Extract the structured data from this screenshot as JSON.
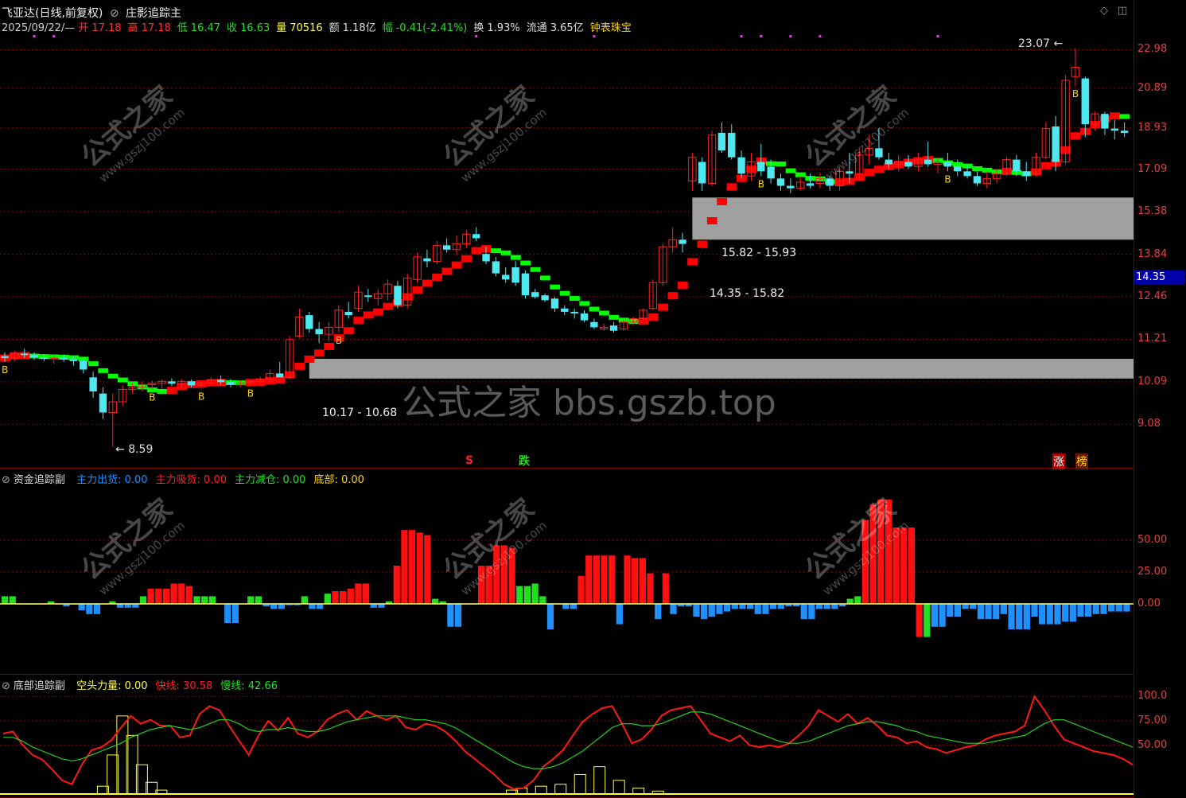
{
  "header": {
    "stock_name": "飞亚达(日线,前复权)",
    "indicator_name": "庄影追踪主",
    "date": "2025/09/22/—",
    "open_label": "开",
    "open": "17.18",
    "high_label": "高",
    "high": "17.18",
    "low_label": "低",
    "low": "16.47",
    "close_label": "收",
    "close": "16.63",
    "volume_label": "量",
    "volume": "70516",
    "amount_label": "额",
    "amount": "1.18亿",
    "change_label": "幅",
    "change": "-0.41(-2.41%)",
    "turnover_label": "换",
    "turnover": "1.93%",
    "float_label": "流通",
    "float": "3.65亿",
    "sector": "钟表珠宝"
  },
  "colors": {
    "up": "#ff2020",
    "down": "#50e8f0",
    "ma_up": "#ff0000",
    "ma_down": "#00ff00",
    "grid": "#8b0000",
    "gray_box": "#a0a0a0"
  },
  "price_axis": [
    "22.98",
    "20.89",
    "18.93",
    "17.09",
    "15.38",
    "13.84",
    "12.46",
    "11.21",
    "10.09",
    "9.08"
  ],
  "current_price": "14.35",
  "annotations": {
    "high_mark": "23.07",
    "low_mark": "8.59",
    "box_upper_top": "15.82 - 15.93",
    "box_upper_bottom": "14.35 - 15.82",
    "box_lower": "10.17 - 10.68",
    "signal_s": "S",
    "signal_die": "跌",
    "signal_zhang": "涨",
    "signal_bang": "榜",
    "buy_mark": "B",
    "watermark_cn": "公式之家",
    "watermark_url": "www.gszj100.com",
    "watermark_big": "公式之家 bbs.gszb.top"
  },
  "panel2": {
    "title": "资金追踪副",
    "items": [
      {
        "label": "主力出货:",
        "value": "0.00",
        "color": "#1e90ff"
      },
      {
        "label": "主力吸货:",
        "value": "0.00",
        "color": "#ff2020"
      },
      {
        "label": "主力减仓:",
        "value": "0.00",
        "color": "#20e020"
      },
      {
        "label": "底部:",
        "value": "0.00",
        "color": "#ffd700"
      }
    ],
    "axis": [
      "50.00",
      "25.00",
      "0.00"
    ]
  },
  "panel3": {
    "title": "底部追踪副",
    "items": [
      {
        "label": "空头力量:",
        "value": "0.00",
        "color": "#ffff40"
      },
      {
        "label": "快线:",
        "value": "30.58",
        "color": "#ff2020"
      },
      {
        "label": "慢线:",
        "value": "42.66",
        "color": "#20e020"
      }
    ],
    "axis": [
      "100.0",
      "75.00",
      "50.00"
    ]
  },
  "chart_data": [
    {
      "type": "candlestick",
      "title": "庄影追踪主",
      "ylim": [
        8.2,
        24.5
      ],
      "log_scale": true,
      "candles": [
        [
          10.75,
          10.85,
          10.6,
          10.7
        ],
        [
          10.7,
          10.9,
          10.62,
          10.82
        ],
        [
          10.82,
          10.95,
          10.7,
          10.78
        ],
        [
          10.78,
          10.85,
          10.65,
          10.72
        ],
        [
          10.72,
          10.8,
          10.62,
          10.68
        ],
        [
          10.68,
          10.78,
          10.55,
          10.7
        ],
        [
          10.7,
          10.8,
          10.6,
          10.66
        ],
        [
          10.66,
          10.74,
          10.5,
          10.62
        ],
        [
          10.62,
          10.68,
          10.3,
          10.4
        ],
        [
          10.2,
          10.35,
          9.7,
          9.85
        ],
        [
          9.8,
          9.95,
          9.2,
          9.35
        ],
        [
          9.35,
          9.8,
          8.59,
          9.6
        ],
        [
          9.6,
          10.0,
          9.5,
          9.9
        ],
        [
          9.9,
          10.05,
          9.8,
          9.95
        ],
        [
          9.95,
          10.1,
          9.85,
          10.02
        ],
        [
          10.02,
          10.12,
          9.9,
          10.05
        ],
        [
          10.05,
          10.15,
          9.92,
          10.1
        ],
        [
          10.1,
          10.18,
          9.98,
          10.04
        ],
        [
          10.04,
          10.16,
          9.96,
          10.1
        ],
        [
          10.1,
          10.15,
          9.95,
          10.0
        ],
        [
          10.0,
          10.1,
          9.92,
          10.06
        ],
        [
          10.06,
          10.2,
          9.98,
          10.14
        ],
        [
          10.14,
          10.25,
          10.0,
          10.08
        ],
        [
          10.08,
          10.16,
          9.95,
          10.02
        ],
        [
          10.02,
          10.12,
          9.96,
          10.06
        ],
        [
          10.06,
          10.15,
          10.0,
          10.1
        ],
        [
          10.1,
          10.22,
          10.02,
          10.16
        ],
        [
          10.16,
          10.4,
          10.08,
          10.3
        ],
        [
          10.3,
          10.6,
          10.2,
          10.2
        ],
        [
          10.2,
          11.3,
          10.15,
          11.2
        ],
        [
          11.3,
          12.1,
          11.25,
          11.85
        ],
        [
          11.9,
          12.0,
          11.4,
          11.5
        ],
        [
          11.5,
          11.7,
          11.1,
          11.35
        ],
        [
          11.35,
          11.7,
          11.15,
          11.55
        ],
        [
          11.55,
          12.2,
          11.4,
          12.05
        ],
        [
          12.0,
          12.3,
          11.8,
          11.9
        ],
        [
          12.1,
          12.8,
          12.0,
          12.6
        ],
        [
          12.5,
          12.7,
          12.3,
          12.45
        ],
        [
          12.4,
          12.7,
          12.2,
          12.55
        ],
        [
          12.55,
          13.0,
          12.35,
          12.85
        ],
        [
          12.8,
          12.95,
          12.1,
          12.2
        ],
        [
          12.2,
          13.2,
          12.1,
          13.05
        ],
        [
          13.0,
          13.9,
          12.9,
          13.75
        ],
        [
          13.7,
          14.0,
          13.4,
          13.6
        ],
        [
          13.6,
          14.3,
          13.5,
          14.15
        ],
        [
          14.15,
          14.4,
          13.9,
          14.0
        ],
        [
          14.0,
          14.5,
          13.8,
          14.2
        ],
        [
          14.2,
          14.7,
          14.05,
          14.55
        ],
        [
          14.55,
          14.8,
          14.3,
          14.4
        ],
        [
          13.85,
          14.1,
          13.5,
          13.6
        ],
        [
          13.6,
          13.75,
          13.1,
          13.2
        ],
        [
          13.15,
          13.4,
          12.9,
          13.0
        ],
        [
          13.4,
          13.6,
          12.8,
          12.9
        ],
        [
          13.2,
          13.3,
          12.4,
          12.5
        ],
        [
          12.6,
          12.7,
          12.4,
          12.45
        ],
        [
          12.5,
          12.55,
          12.3,
          12.35
        ],
        [
          12.4,
          12.45,
          12.0,
          12.1
        ],
        [
          12.1,
          12.2,
          11.9,
          12.0
        ],
        [
          12.0,
          12.1,
          11.8,
          11.95
        ],
        [
          11.95,
          12.05,
          11.7,
          11.75
        ],
        [
          11.7,
          11.8,
          11.5,
          11.55
        ],
        [
          11.5,
          11.65,
          11.45,
          11.55
        ],
        [
          11.6,
          11.7,
          11.4,
          11.45
        ],
        [
          11.5,
          11.75,
          11.45,
          11.7
        ],
        [
          11.7,
          11.85,
          11.6,
          11.8
        ],
        [
          11.8,
          12.1,
          11.75,
          12.05
        ],
        [
          12.1,
          13.0,
          12.05,
          12.9
        ],
        [
          12.9,
          14.2,
          12.8,
          14.1
        ],
        [
          14.1,
          14.8,
          13.9,
          14.35
        ],
        [
          14.35,
          14.6,
          13.9,
          14.2
        ],
        [
          16.6,
          17.8,
          16.2,
          17.6
        ],
        [
          17.4,
          17.6,
          16.2,
          16.5
        ],
        [
          16.5,
          18.8,
          16.4,
          18.6
        ],
        [
          18.7,
          19.2,
          17.8,
          17.9
        ],
        [
          18.7,
          19.1,
          17.5,
          17.6
        ],
        [
          17.6,
          17.9,
          16.7,
          16.9
        ],
        [
          16.8,
          17.8,
          16.6,
          17.4
        ],
        [
          17.4,
          18.2,
          16.8,
          17.0
        ],
        [
          17.2,
          17.5,
          16.5,
          16.7
        ],
        [
          16.7,
          16.9,
          16.2,
          16.4
        ],
        [
          16.4,
          16.7,
          16.1,
          16.3
        ],
        [
          16.3,
          16.8,
          16.2,
          16.55
        ],
        [
          16.5,
          16.9,
          16.3,
          16.4
        ],
        [
          16.5,
          16.95,
          16.3,
          16.7
        ],
        [
          16.7,
          16.8,
          16.2,
          16.4
        ],
        [
          16.4,
          17.2,
          16.2,
          17.0
        ],
        [
          17.0,
          17.8,
          16.5,
          16.9
        ],
        [
          16.9,
          18.0,
          16.6,
          17.7
        ],
        [
          17.7,
          18.6,
          17.3,
          18.0
        ],
        [
          18.0,
          18.9,
          17.5,
          17.6
        ],
        [
          17.5,
          17.8,
          17.1,
          17.3
        ],
        [
          17.3,
          17.7,
          17.0,
          17.4
        ],
        [
          17.4,
          17.7,
          17.1,
          17.2
        ],
        [
          17.2,
          17.8,
          17.0,
          17.5
        ],
        [
          17.5,
          18.3,
          17.2,
          17.3
        ],
        [
          17.3,
          17.6,
          16.9,
          17.4
        ],
        [
          17.4,
          17.8,
          17.0,
          17.2
        ],
        [
          17.2,
          17.5,
          16.8,
          17.0
        ],
        [
          17.0,
          17.3,
          16.7,
          16.8
        ],
        [
          16.8,
          17.0,
          16.4,
          16.5
        ],
        [
          16.5,
          17.0,
          16.3,
          16.7
        ],
        [
          16.7,
          17.1,
          16.5,
          16.9
        ],
        [
          16.9,
          17.6,
          16.8,
          17.5
        ],
        [
          17.5,
          17.7,
          16.8,
          17.0
        ],
        [
          17.0,
          17.4,
          16.6,
          16.8
        ],
        [
          16.9,
          17.8,
          16.8,
          17.6
        ],
        [
          17.6,
          19.2,
          17.5,
          18.9
        ],
        [
          19.0,
          19.5,
          17.0,
          17.4
        ],
        [
          17.4,
          21.6,
          17.3,
          21.3
        ],
        [
          21.5,
          23.07,
          21.0,
          22.0
        ],
        [
          21.4,
          21.5,
          18.5,
          19.1
        ],
        [
          19.1,
          19.7,
          18.8,
          19.6
        ],
        [
          19.6,
          19.7,
          18.6,
          18.9
        ],
        [
          18.9,
          19.3,
          18.4,
          18.8
        ],
        [
          18.8,
          19.2,
          18.5,
          18.7
        ]
      ],
      "gray_boxes": [
        {
          "low": 14.35,
          "high": 15.93
        },
        {
          "low": 10.17,
          "high": 10.68
        }
      ]
    },
    {
      "type": "bar",
      "title": "资金追踪副",
      "ylim": [
        -60,
        100
      ],
      "values": [
        6,
        6,
        0,
        0,
        0,
        0,
        2,
        0,
        -2,
        0,
        -5,
        -8,
        -8,
        0,
        2,
        -3,
        -3,
        -3,
        6,
        12,
        12,
        12,
        16,
        16,
        14,
        6,
        6,
        6,
        0,
        -15,
        -15,
        0,
        6,
        6,
        -2,
        -4,
        -4,
        -1,
        -1,
        6,
        -4,
        -4,
        8,
        10,
        10,
        12,
        16,
        16,
        -3,
        -3,
        2,
        30,
        58,
        58,
        56,
        54,
        4,
        2,
        -18,
        -18,
        0,
        0,
        30,
        30,
        46,
        46,
        44,
        14,
        14,
        16,
        6,
        -20,
        0,
        -4,
        -4,
        22,
        38,
        38,
        38,
        38,
        -16,
        38,
        36,
        36,
        24,
        -12,
        24,
        -8,
        -2,
        -2,
        -10,
        -12,
        -10,
        -8,
        -6,
        -4,
        -4,
        -4,
        -8,
        -8,
        -4,
        -4,
        -2,
        -2,
        -12,
        -12,
        -4,
        -4,
        -4,
        -2,
        4,
        6,
        66,
        78,
        82,
        82,
        60,
        60,
        60,
        -26,
        -26,
        -18,
        -18,
        -10,
        -10,
        -4,
        -4,
        -12,
        -12,
        -12,
        -8,
        -20,
        -20,
        -20,
        -10,
        -16,
        -16,
        -16,
        -14,
        -14,
        -10,
        -10,
        -8,
        -8,
        -6,
        -6,
        -6
      ]
    },
    {
      "type": "line",
      "title": "底部追踪副",
      "ylim": [
        0,
        110
      ],
      "series": [
        {
          "name": "快线",
          "values": [
            62,
            64,
            50,
            40,
            35,
            25,
            14,
            10,
            30,
            45,
            48,
            55,
            68,
            80,
            72,
            76,
            70,
            70,
            58,
            60,
            82,
            90,
            86,
            70,
            55,
            40,
            60,
            75,
            65,
            78,
            62,
            58,
            64,
            76,
            82,
            86,
            76,
            85,
            80,
            76,
            80,
            68,
            66,
            72,
            70,
            64,
            55,
            44,
            36,
            28,
            20,
            10,
            5,
            6,
            14,
            28,
            36,
            45,
            60,
            74,
            82,
            88,
            90,
            72,
            52,
            56,
            66,
            80,
            86,
            88,
            90,
            76,
            62,
            58,
            54,
            60,
            50,
            48,
            50,
            48,
            52,
            60,
            70,
            86,
            80,
            74,
            82,
            72,
            78,
            70,
            60,
            58,
            52,
            54,
            48,
            46,
            42,
            45,
            48,
            50,
            56,
            60,
            62,
            64,
            70,
            100,
            86,
            70,
            56,
            52,
            48,
            44,
            42,
            40,
            36,
            30
          ]
        },
        {
          "name": "慢线",
          "values": [
            58,
            58,
            54,
            48,
            44,
            40,
            36,
            34,
            36,
            40,
            44,
            48,
            52,
            58,
            62,
            66,
            68,
            70,
            68,
            66,
            68,
            72,
            76,
            76,
            72,
            66,
            64,
            66,
            66,
            68,
            66,
            64,
            64,
            66,
            70,
            74,
            76,
            78,
            80,
            80,
            80,
            78,
            76,
            76,
            74,
            72,
            68,
            62,
            56,
            50,
            44,
            38,
            32,
            28,
            26,
            26,
            28,
            32,
            38,
            44,
            52,
            60,
            68,
            72,
            72,
            70,
            70,
            72,
            76,
            80,
            84,
            84,
            82,
            78,
            74,
            70,
            66,
            62,
            58,
            54,
            52,
            52,
            54,
            58,
            62,
            66,
            70,
            72,
            74,
            74,
            72,
            70,
            66,
            64,
            60,
            58,
            56,
            54,
            52,
            52,
            52,
            54,
            56,
            58,
            60,
            66,
            72,
            76,
            76,
            72,
            68,
            64,
            60,
            56,
            52,
            48
          ]
        }
      ]
    }
  ]
}
